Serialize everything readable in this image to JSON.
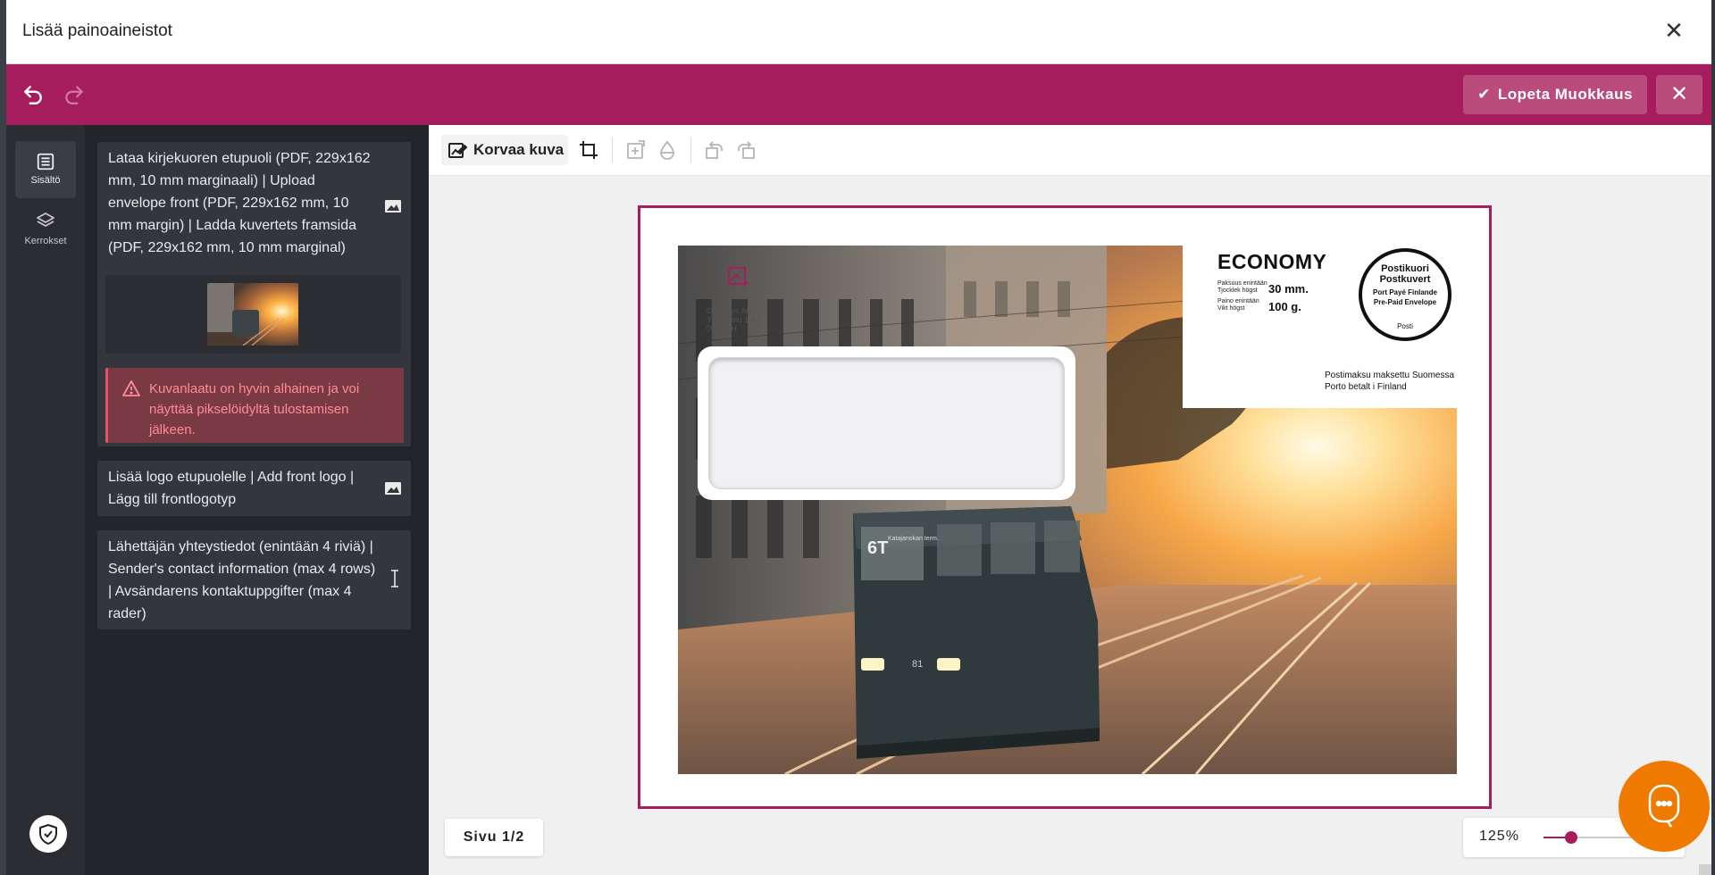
{
  "modal": {
    "title": "Lisää painoaineistot"
  },
  "toolbar": {
    "finish_label": "Lopeta Muokkaus"
  },
  "rail": {
    "items": [
      {
        "label": "Sisältö",
        "icon": "list-icon",
        "active": true
      },
      {
        "label": "Kerrokset",
        "icon": "layers-icon",
        "active": false
      }
    ]
  },
  "content": {
    "cards": [
      {
        "text": "Lataa kirjekuoren etupuoli (PDF, 229x162 mm, 10 mm marginaali) | Upload envelope front (PDF, 229x162 mm, 10 mm margin) | Ladda kuvertets framsida (PDF, 229x162 mm, 10 mm marginal)",
        "icon": "image-icon"
      },
      {
        "text": "Lisää logo etupuolelle | Add front logo | Lägg till frontlogotyp",
        "icon": "image-icon"
      },
      {
        "text": "Lähettäjän yhteystiedot (enintään 4 riviä) | Sender's contact information (max 4 rows) | Avsändarens kontaktuppgifter (max 4 rader)",
        "icon": "text-cursor-icon"
      }
    ],
    "warning": "Kuvanlaatu on hyvin alhainen ja voi näyttää pikselöidyltä tulostamisen jälkeen."
  },
  "canvas": {
    "replace_label": "Korvaa kuva",
    "page_label": "Sivu 1/2",
    "zoom_label": "125%",
    "zoom_level": 0.28
  },
  "envelope": {
    "economy": "ECONOMY",
    "thickness_label_fi": "Paksuus enintään",
    "thickness_label_sv": "Tjocklek högst",
    "thickness_value": "30 mm.",
    "weight_label_fi": "Paino enintään",
    "weight_label_sv": "Vikt högst",
    "weight_value": "100 g.",
    "stamp_line1": "Postikuori",
    "stamp_line2": "Postkuvert",
    "stamp_line3": "Port Payé Finlande",
    "stamp_line4": "Pre-Paid Envelope",
    "stamp_line5": "Posti",
    "paid_fi": "Postimaksu maksettu Suomessa",
    "paid_sv": "Porto betalt i Finland",
    "sender_line1": "Oy Yritys Ab",
    "sender_line2": "Yrityskatu 1 A 1",
    "sender_line3": "00100 H",
    "tram_sign": "Katajanokan term."
  },
  "colors": {
    "brand": "#a51d5d",
    "chat": "#f07a00",
    "warning_text": "#ff8a98"
  }
}
